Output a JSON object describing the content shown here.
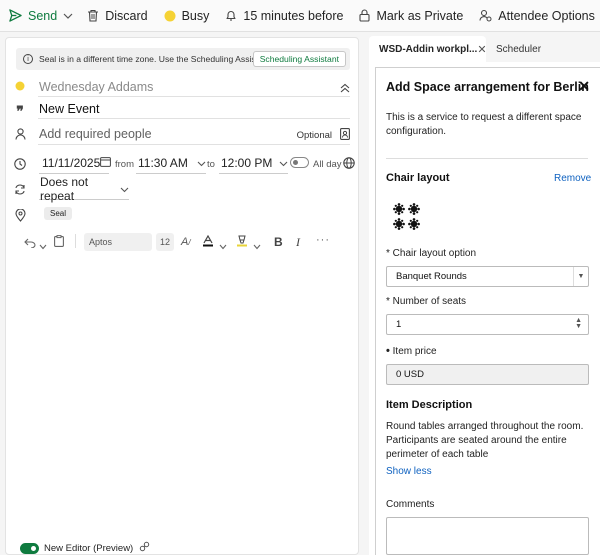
{
  "toolbar": {
    "send": "Send",
    "discard": "Discard",
    "busy": "Busy",
    "reminder": "15 minutes before",
    "mark_private": "Mark as Private",
    "attendee_options": "Attendee Options",
    "more": "···"
  },
  "infobar": {
    "message": "Seal is in a different time zone. Use the Scheduling Assistant to selec...",
    "button": "Scheduling Assistant"
  },
  "event": {
    "calendar_owner": "Wednesday Addams",
    "title": "New Event",
    "attendees_placeholder": "Add required people",
    "optional": "Optional",
    "start_date": "11/11/2025",
    "from_label": "from",
    "start_time": "11:30 AM",
    "to_label": "to",
    "end_time": "12:00 PM",
    "all_day": "All day",
    "repeat": "Does not repeat",
    "location_chip": "Seal"
  },
  "editor": {
    "font": "Aptos",
    "size": "12",
    "new_editor": "New Editor (Preview)"
  },
  "tabs": {
    "active": "WSD-Addin workpl...",
    "inactive": "Scheduler"
  },
  "panel": {
    "title": "Add Space arrangement for Berlin",
    "description": "This is a service to request a different space configuration.",
    "chair_layout_heading": "Chair layout",
    "remove": "Remove",
    "chair_layout_option_label": "* Chair layout option",
    "chair_layout_option_value": "Banquet Rounds",
    "seats_label": "* Number of seats",
    "seats_value": "1",
    "price_label": "Item price",
    "price_value": "0 USD",
    "item_description_heading": "Item Description",
    "item_description": "Round tables arranged throughout the room. Participants are seated around the entire perimeter of each table",
    "show_less": "Show less",
    "comments_label": "Comments"
  },
  "colors": {
    "accent_green": "#0f7b3f",
    "link_blue": "#0f62c0",
    "busy_yellow": "#f5d234"
  }
}
